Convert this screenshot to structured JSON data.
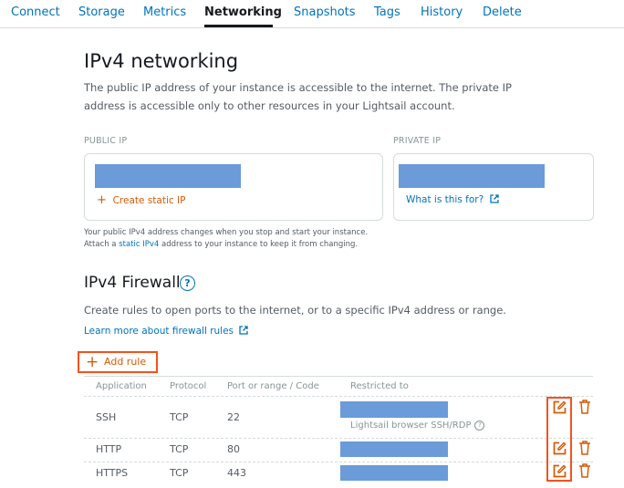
{
  "tabs": [
    "Connect",
    "Storage",
    "Metrics",
    "Networking",
    "Snapshots",
    "Tags",
    "History",
    "Delete"
  ],
  "active_tab": "Networking",
  "ipv4": {
    "title": "IPv4 networking",
    "description": "The public IP address of your instance is accessible to the internet. The private IP address is accessible only to other resources in your Lightsail account.",
    "public_ip_label": "PUBLIC IP",
    "private_ip_label": "PRIVATE IP",
    "create_static_ip": "Create static IP",
    "what_is_this": "What is this for?",
    "note_line1": "Your public IPv4 address changes when you stop and start your instance.",
    "note_prefix": "Attach a ",
    "note_link": "static IPv4",
    "note_suffix": " address to your instance to keep it from changing."
  },
  "firewall": {
    "title": "IPv4 Firewall",
    "description": "Create rules to open ports to the internet, or to a specific IPv4 address or range.",
    "learn_more": "Learn more about firewall rules",
    "add_rule": "Add rule",
    "columns": [
      "Application",
      "Protocol",
      "Port or range / Code",
      "Restricted to"
    ],
    "rows": [
      {
        "application": "SSH",
        "protocol": "TCP",
        "port": "22",
        "restricted_note": "Lightsail browser SSH/RDP"
      },
      {
        "application": "HTTP",
        "protocol": "TCP",
        "port": "80",
        "restricted_note": ""
      },
      {
        "application": "HTTPS",
        "protocol": "TCP",
        "port": "443",
        "restricted_note": ""
      }
    ]
  },
  "colors": {
    "link": "#0073bb",
    "accent_orange": "#d45b07",
    "highlight_box": "#f5511d",
    "redaction": "#6b9bd8"
  },
  "icons": {
    "edit": "edit-icon",
    "delete": "trash-icon",
    "help": "help-circle-icon",
    "external": "external-link-icon",
    "plus": "plus-icon"
  }
}
